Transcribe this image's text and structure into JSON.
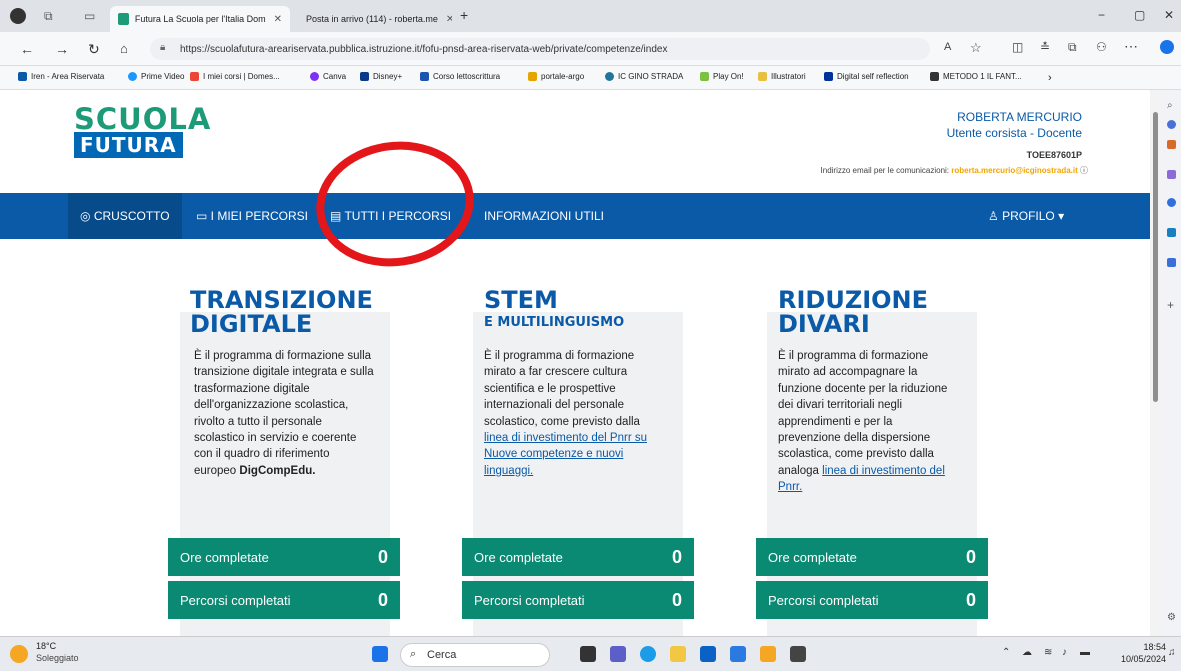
{
  "browser": {
    "tabs": [
      {
        "label": "Futura La Scuola per l'Italia Dom",
        "active": true
      },
      {
        "label": "Posta in arrivo (114) - roberta.me",
        "active": false
      }
    ],
    "new_tab": "+",
    "url": "https://scuolafutura-areariservata.pubblica.istruzione.it/fofu-pnsd-area-riservata-web/private/competenze/index",
    "bookmarks": [
      "Iren - Area Riservata",
      "Prime Video",
      "I miei corsi | Domes...",
      "Canva",
      "Disney+",
      "Corso lettoscrittura",
      "portale-argo",
      "IC GINO STRADA",
      "Play On!",
      "Illustratori",
      "Digital self reflection",
      "METODO 1 IL FANT..."
    ]
  },
  "header": {
    "logo_top": "SCUOLA",
    "logo_bottom": "FUTURA",
    "user_name": "ROBERTA MERCURIO",
    "user_role": "Utente corsista - Docente",
    "school_code": "TOEE87601P",
    "email_label": "Indirizzo email per le comunicazioni:",
    "email": "roberta.mercurio@icginostrada.it"
  },
  "nav": {
    "items": [
      "CRUSCOTTO",
      "I MIEI PERCORSI",
      "TUTTI I PERCORSI",
      "INFORMAZIONI UTILI"
    ],
    "profile": "PROFILO"
  },
  "columns": [
    {
      "title_line1": "TRANSIZIONE",
      "title_line2": "DIGITALE",
      "subtitle": "",
      "desc": "È il programma di formazione sulla transizione digitale integrata e sulla trasformazione digitale dell'organizzazione scolastica, rivolto a tutto il personale scolastico in servizio e coerente con il quadro di riferimento europeo",
      "desc_bold": "DigCompEdu.",
      "desc_link": "",
      "hours_label": "Ore completate",
      "hours_value": "0",
      "paths_label": "Percorsi completati",
      "paths_value": "0"
    },
    {
      "title_line1": "STEM",
      "title_line2": "",
      "subtitle": "E MULTILINGUISMO",
      "desc": "È il programma di formazione mirato a far crescere cultura scientifica e le prospettive internazionali del personale scolastico, come previsto dalla",
      "desc_bold": "",
      "desc_link": "linea di investimento del Pnrr su Nuove competenze e nuovi linguaggi.",
      "hours_label": "Ore completate",
      "hours_value": "0",
      "paths_label": "Percorsi completati",
      "paths_value": "0"
    },
    {
      "title_line1": "RIDUZIONE",
      "title_line2": "DIVARI",
      "subtitle": "",
      "desc": "È il programma di formazione mirato ad accompagnare la funzione docente per la riduzione dei divari territoriali negli apprendimenti e per la prevenzione della dispersione scolastica, come previsto dalla analoga",
      "desc_bold": "",
      "desc_link": "linea di investimento del Pnrr.",
      "hours_label": "Ore completate",
      "hours_value": "0",
      "paths_label": "Percorsi completati",
      "paths_value": "0"
    }
  ],
  "taskbar": {
    "weather_temp": "18°C",
    "weather_desc": "Soleggiato",
    "search_placeholder": "Cerca",
    "time": "18:54",
    "date": "10/05/2024"
  },
  "colors": {
    "brand_blue": "#0a5aa8",
    "brand_green": "#0b8a73",
    "annotation_red": "#e3161a"
  }
}
